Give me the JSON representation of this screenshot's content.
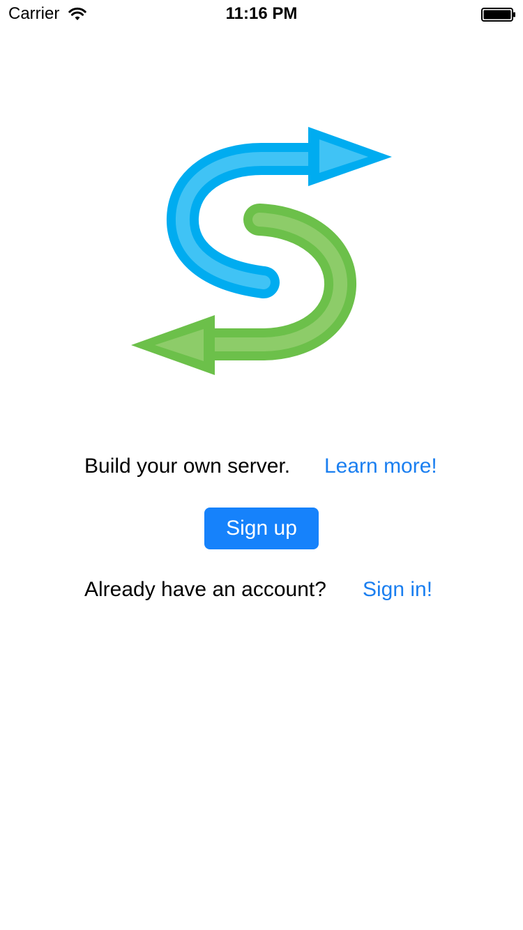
{
  "status_bar": {
    "carrier": "Carrier",
    "time": "11:16 PM"
  },
  "logo": {
    "icon": "s-arrows-logo-icon",
    "colors": {
      "blue_outer": "#00acf0",
      "blue_inner": "#40c3f5",
      "green_outer": "#6cc04a",
      "green_inner": "#8dcc69"
    }
  },
  "main": {
    "tagline": "Build your own server.",
    "learn_more_link": "Learn more!",
    "signup_button": "Sign up",
    "account_prompt": "Already have an account?",
    "signin_link": "Sign in!"
  },
  "colors": {
    "link": "#1b7ff0",
    "button": "#1682fb",
    "background": "#ffffff"
  }
}
